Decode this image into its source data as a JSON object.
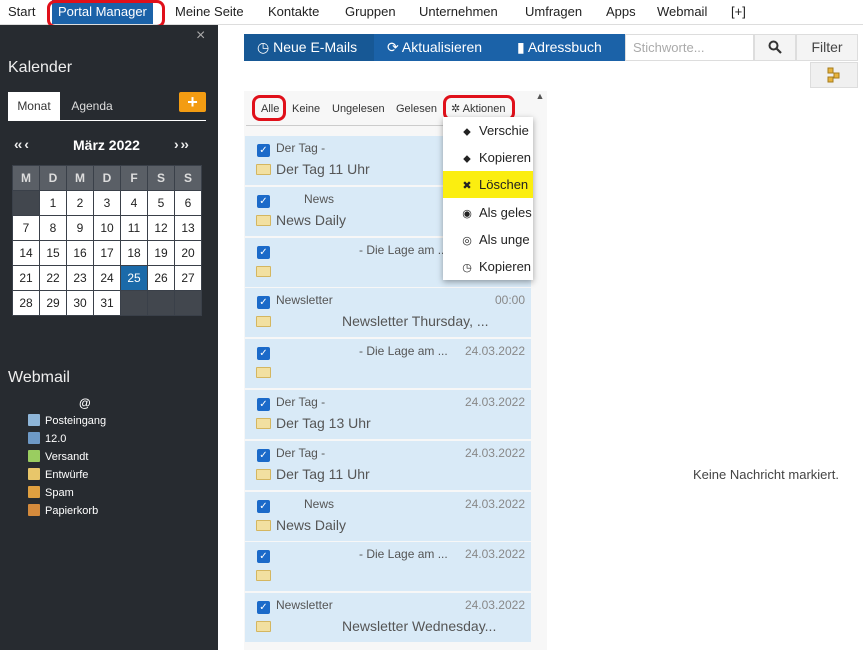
{
  "nav": {
    "items": [
      "Start",
      "Portal Manager",
      "Meine Seite",
      "Kontakte",
      "Gruppen",
      "Unternehmen",
      "Umfragen",
      "Apps",
      "Webmail",
      "[+]"
    ]
  },
  "sidebar": {
    "calendar_title": "Kalender",
    "tabs": [
      "Monat",
      "Agenda"
    ],
    "add_symbol": "+",
    "month_label": "März 2022",
    "prev_symbol": "‹‹ ‹",
    "next_symbol": "› ››",
    "weekday_headers": [
      "M",
      "D",
      "M",
      "D",
      "F",
      "S",
      "S"
    ],
    "weeks": [
      [
        "",
        "1",
        "2",
        "3",
        "4",
        "5",
        "6"
      ],
      [
        "7",
        "8",
        "9",
        "10",
        "11",
        "12",
        "13"
      ],
      [
        "14",
        "15",
        "16",
        "17",
        "18",
        "19",
        "20"
      ],
      [
        "21",
        "22",
        "23",
        "24",
        "25",
        "26",
        "27"
      ],
      [
        "28",
        "29",
        "30",
        "31",
        "",
        "",
        ""
      ]
    ],
    "today": "25",
    "event_days": [
      "17",
      "25"
    ],
    "webmail_title": "Webmail",
    "account": "@",
    "folders": [
      "Posteingang",
      "12.0",
      "Versandt",
      "Entwürfe",
      "Spam",
      "Papierkorb"
    ],
    "close_symbol": "×"
  },
  "toolbar": {
    "new_mails": "Neue E-Mails",
    "refresh": "Aktualisieren",
    "addressbook": "Adressbuch",
    "search_placeholder": "Stichworte...",
    "filter": "Filter"
  },
  "list_filters": [
    "Alle",
    "Keine",
    "Ungelesen",
    "Gelesen",
    "Aktionen"
  ],
  "messages": [
    {
      "sender": "Der Tag -",
      "date": "",
      "subject": "Der Tag 11 Uhr"
    },
    {
      "sender": "News",
      "date": "",
      "subject": "News Daily"
    },
    {
      "sender": "- Die Lage am ...",
      "date": "",
      "subject": ""
    },
    {
      "sender": "Newsletter",
      "date": "00:00",
      "subject": "Newsletter Thursday, ..."
    },
    {
      "sender": "- Die Lage am ...",
      "date": "24.03.2022",
      "subject": ""
    },
    {
      "sender": "Der Tag -",
      "date": "24.03.2022",
      "subject": "Der Tag 13 Uhr"
    },
    {
      "sender": "Der Tag -",
      "date": "24.03.2022",
      "subject": "Der Tag 11 Uhr"
    },
    {
      "sender": "News",
      "date": "24.03.2022",
      "subject": "News Daily"
    },
    {
      "sender": "- Die Lage am ...",
      "date": "24.03.2022",
      "subject": ""
    },
    {
      "sender": "Newsletter",
      "date": "24.03.2022",
      "subject": "Newsletter Wednesday..."
    }
  ],
  "actions_menu": [
    {
      "icon": "tag-icon",
      "glyph": "⬥",
      "label": "Verschie"
    },
    {
      "icon": "tags-icon",
      "glyph": "⬥",
      "label": "Kopieren"
    },
    {
      "icon": "times-icon",
      "glyph": "✖",
      "label": "Löschen"
    },
    {
      "icon": "eye-icon",
      "glyph": "◉",
      "label": "Als geles"
    },
    {
      "icon": "eye-slash-icon",
      "glyph": "◎",
      "label": "Als unge"
    },
    {
      "icon": "clock-icon",
      "glyph": "◷",
      "label": "Kopieren"
    }
  ],
  "highlighted_action": "Löschen",
  "reading_pane": {
    "empty_text": "Keine Nachricht markiert."
  },
  "colors": {
    "accent": "#1b62a8",
    "highlight": "#fbee10",
    "annotation": "#e0101a"
  }
}
